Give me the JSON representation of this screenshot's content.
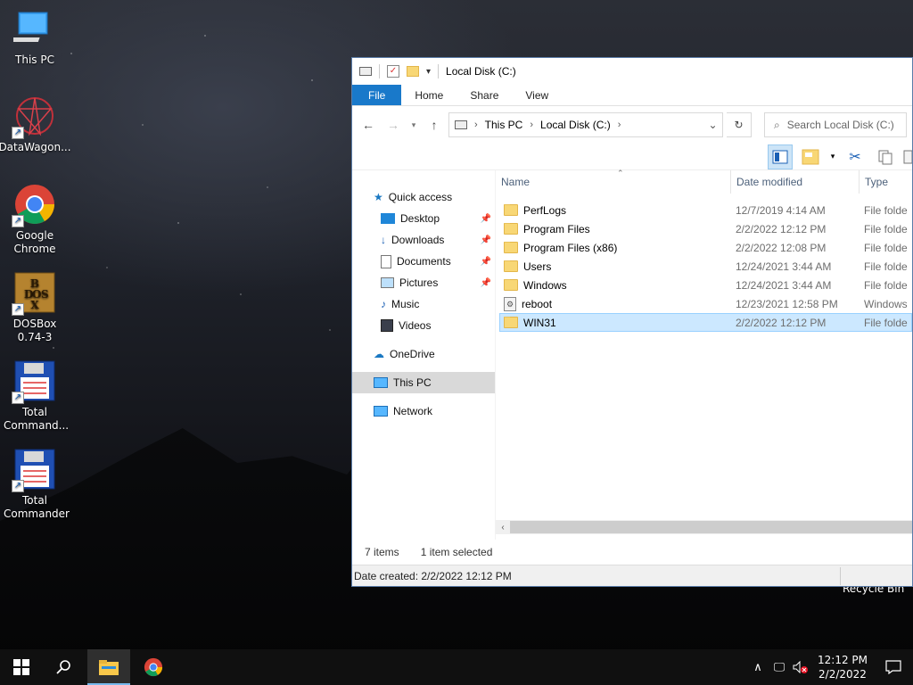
{
  "desktop": {
    "icons": [
      {
        "label": "This PC"
      },
      {
        "label": "DataWagon..."
      },
      {
        "label": "Google Chrome"
      },
      {
        "label": "DOSBox 0.74-3"
      },
      {
        "label": "Total Command..."
      },
      {
        "label": "Total Commander"
      }
    ],
    "recycle_bin": "Recycle Bin"
  },
  "explorer": {
    "title": "Local Disk (C:)",
    "ribbon_tabs": [
      "File",
      "Home",
      "Share",
      "View"
    ],
    "breadcrumb": [
      "This PC",
      "Local Disk (C:)"
    ],
    "search_placeholder": "Search Local Disk (C:)",
    "nav": {
      "quick_access": "Quick access",
      "items": [
        "Desktop",
        "Downloads",
        "Documents",
        "Pictures",
        "Music",
        "Videos"
      ],
      "onedrive": "OneDrive",
      "this_pc": "This PC",
      "network": "Network"
    },
    "columns": {
      "name": "Name",
      "date": "Date modified",
      "type": "Type"
    },
    "files": [
      {
        "name": "PerfLogs",
        "date": "12/7/2019 4:14 AM",
        "type": "File folde",
        "icon": "folder-icon"
      },
      {
        "name": "Program Files",
        "date": "2/2/2022 12:12 PM",
        "type": "File folde",
        "icon": "folder-icon"
      },
      {
        "name": "Program Files (x86)",
        "date": "2/2/2022 12:08 PM",
        "type": "File folde",
        "icon": "folder-icon"
      },
      {
        "name": "Users",
        "date": "12/24/2021 3:44 AM",
        "type": "File folde",
        "icon": "folder-icon"
      },
      {
        "name": "Windows",
        "date": "12/24/2021 3:44 AM",
        "type": "File folde",
        "icon": "folder-icon"
      },
      {
        "name": "reboot",
        "date": "12/23/2021 12:58 PM",
        "type": "Windows",
        "icon": "settings-file-icon"
      },
      {
        "name": "WIN31",
        "date": "2/2/2022 12:12 PM",
        "type": "File folde",
        "icon": "folder-icon"
      }
    ],
    "status": {
      "items": "7 items",
      "selected": "1 item selected",
      "detail": "Date created: 2/2/2022 12:12 PM"
    }
  },
  "taskbar": {
    "time": "12:12 PM",
    "date": "2/2/2022"
  },
  "colors": {
    "accent": "#1979ca",
    "selection": "#cce8ff",
    "taskbar": "#101010"
  }
}
